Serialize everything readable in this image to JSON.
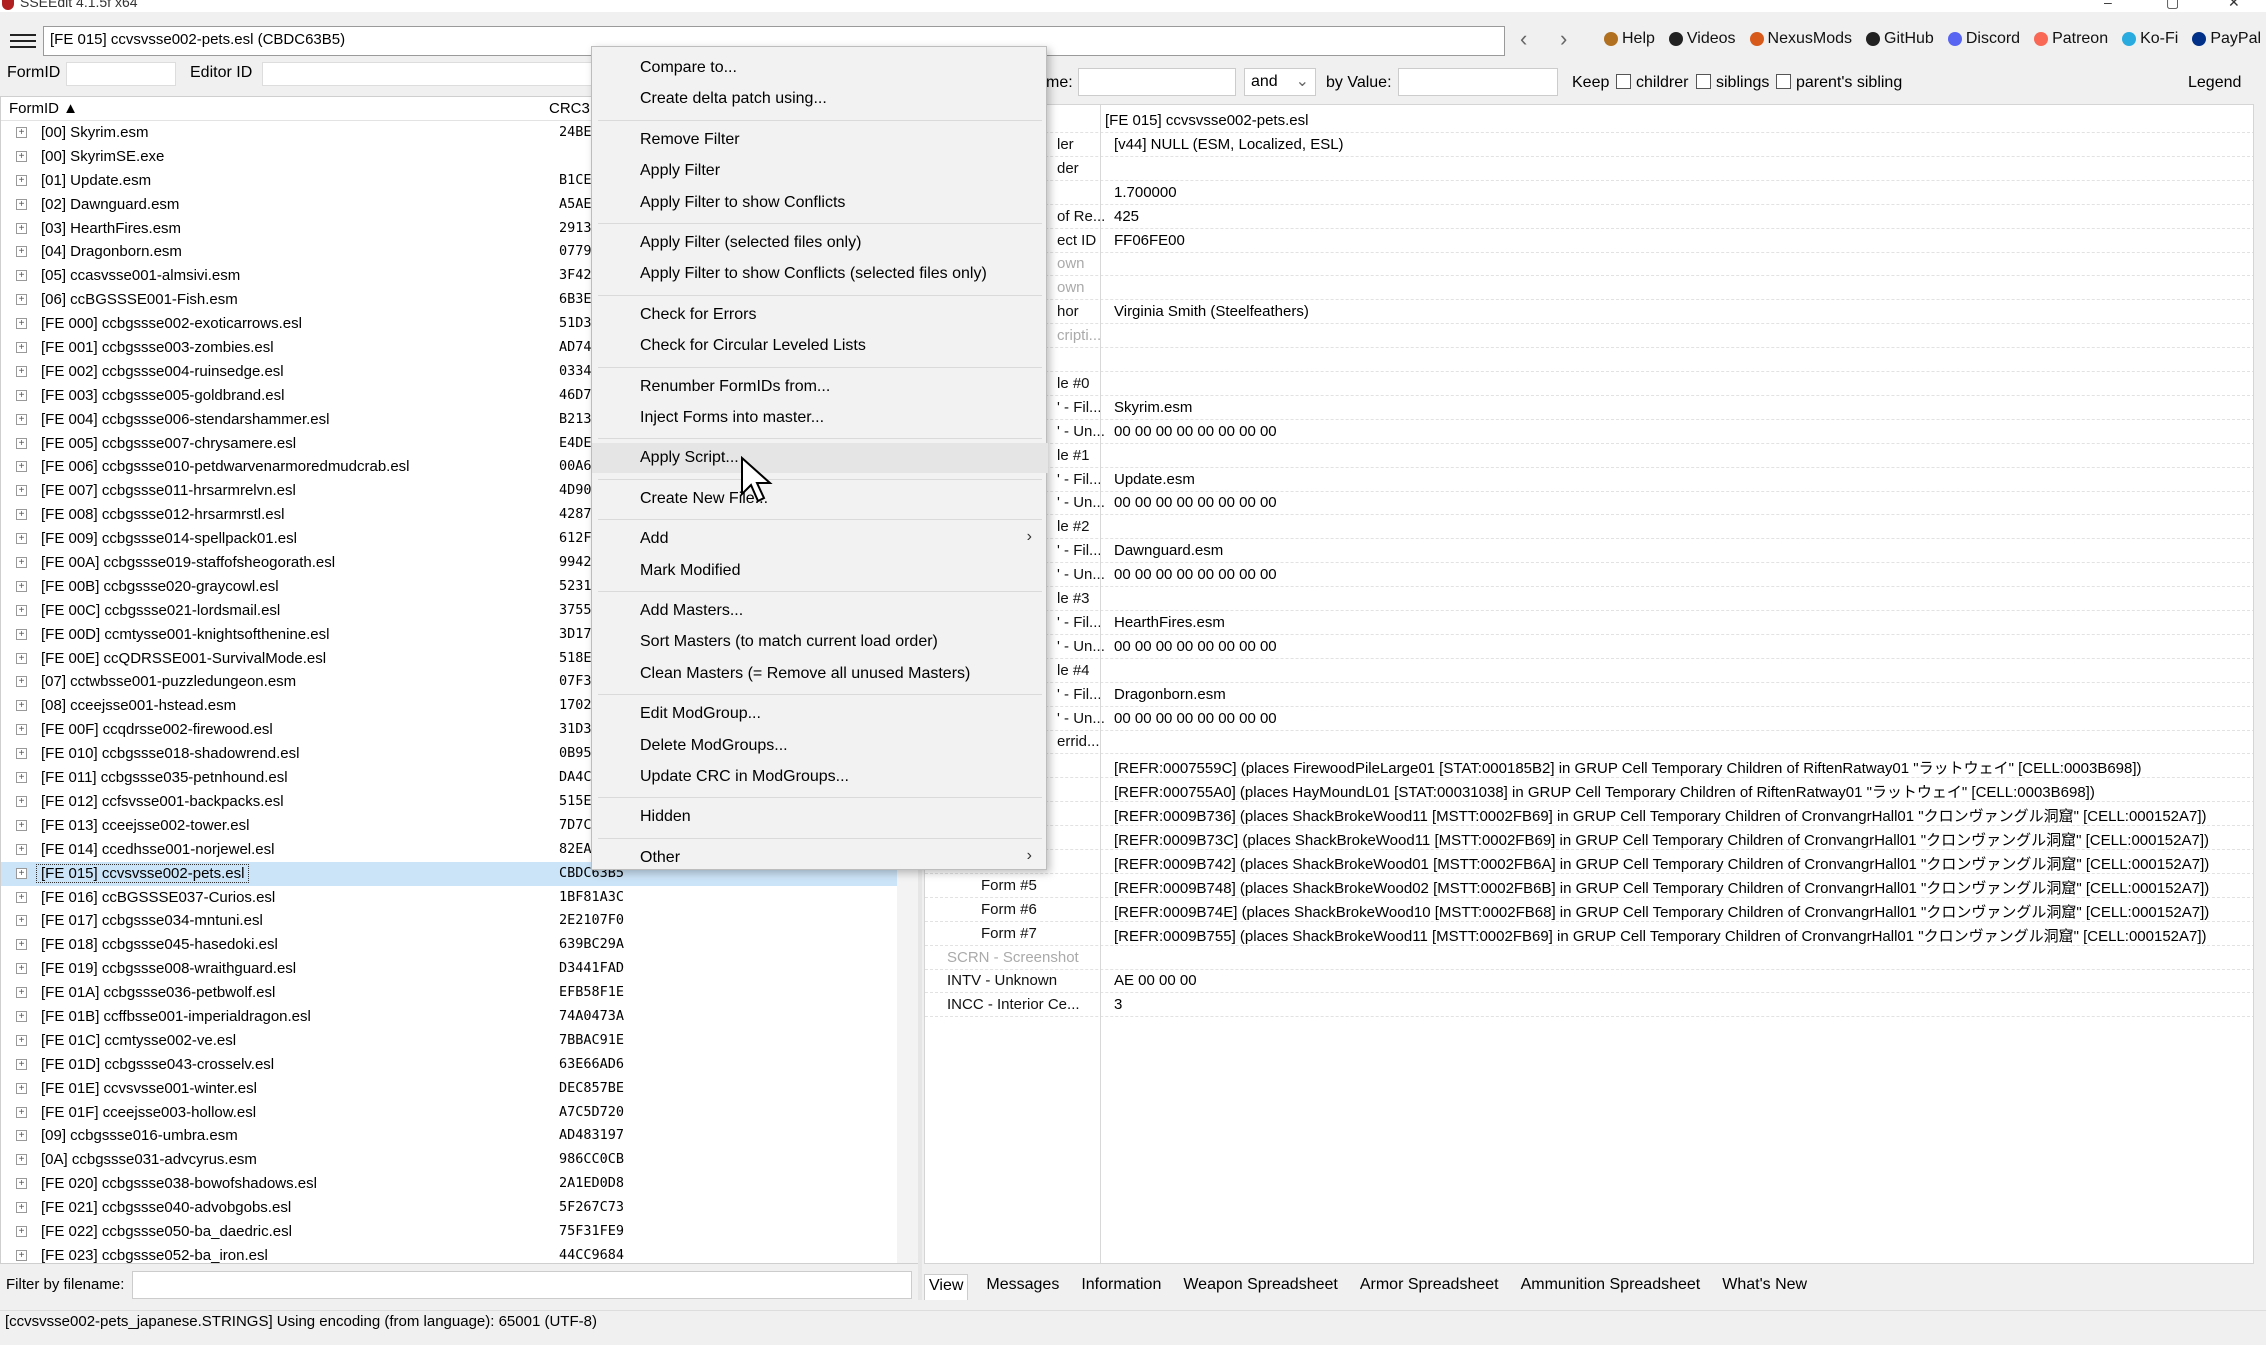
{
  "window": {
    "title": "SSEEdit 4.1.5f x64"
  },
  "toolbar": {
    "path": "[FE 015] ccvsvsse002-pets.esl (CBDC63B5)",
    "links": [
      {
        "label": "Help",
        "icon": "book-icon",
        "color": "#b07020"
      },
      {
        "label": "Videos",
        "icon": "video-icon",
        "color": "#222222"
      },
      {
        "label": "NexusMods",
        "icon": "nexus-icon",
        "color": "#d85a1a"
      },
      {
        "label": "GitHub",
        "icon": "github-icon",
        "color": "#222222"
      },
      {
        "label": "Discord",
        "icon": "discord-icon",
        "color": "#5865f2"
      },
      {
        "label": "Patreon",
        "icon": "patreon-icon",
        "color": "#f96854"
      },
      {
        "label": "Ko-Fi",
        "icon": "kofi-icon",
        "color": "#29abe0"
      },
      {
        "label": "PayPal",
        "icon": "paypal-icon",
        "color": "#003087"
      }
    ]
  },
  "left_header": {
    "formid_label": "FormID",
    "editorid_label": "Editor ID"
  },
  "tree": {
    "columns": [
      "FormID ▲",
      "CRC3"
    ],
    "rows": [
      {
        "name": "[00] Skyrim.esm",
        "crc": "24BE"
      },
      {
        "name": "[00] SkyrimSE.exe",
        "crc": ""
      },
      {
        "name": "[01] Update.esm",
        "crc": "B1CE"
      },
      {
        "name": "[02] Dawnguard.esm",
        "crc": "A5AE"
      },
      {
        "name": "[03] HearthFires.esm",
        "crc": "2913"
      },
      {
        "name": "[04] Dragonborn.esm",
        "crc": "0779"
      },
      {
        "name": "[05] ccasvsse001-almsivi.esm",
        "crc": "3F42"
      },
      {
        "name": "[06] ccBGSSSE001-Fish.esm",
        "crc": "6B3E"
      },
      {
        "name": "[FE 000] ccbgssse002-exoticarrows.esl",
        "crc": "51D3"
      },
      {
        "name": "[FE 001] ccbgssse003-zombies.esl",
        "crc": "AD74"
      },
      {
        "name": "[FE 002] ccbgssse004-ruinsedge.esl",
        "crc": "0334"
      },
      {
        "name": "[FE 003] ccbgssse005-goldbrand.esl",
        "crc": "46D7"
      },
      {
        "name": "[FE 004] ccbgssse006-stendarshammer.esl",
        "crc": "B213"
      },
      {
        "name": "[FE 005] ccbgssse007-chrysamere.esl",
        "crc": "E4DE"
      },
      {
        "name": "[FE 006] ccbgssse010-petdwarvenarmoredmudcrab.esl",
        "crc": "00A6"
      },
      {
        "name": "[FE 007] ccbgssse011-hrsarmrelvn.esl",
        "crc": "4D90"
      },
      {
        "name": "[FE 008] ccbgssse012-hrsarmrstl.esl",
        "crc": "4287"
      },
      {
        "name": "[FE 009] ccbgssse014-spellpack01.esl",
        "crc": "612F"
      },
      {
        "name": "[FE 00A] ccbgssse019-staffofsheogorath.esl",
        "crc": "9942"
      },
      {
        "name": "[FE 00B] ccbgssse020-graycowl.esl",
        "crc": "5231"
      },
      {
        "name": "[FE 00C] ccbgssse021-lordsmail.esl",
        "crc": "3755"
      },
      {
        "name": "[FE 00D] ccmtysse001-knightsofthenine.esl",
        "crc": "3D17"
      },
      {
        "name": "[FE 00E] ccQDRSSE001-SurvivalMode.esl",
        "crc": "518E"
      },
      {
        "name": "[07] cctwbsse001-puzzledungeon.esm",
        "crc": "07F3"
      },
      {
        "name": "[08] cceejsse001-hstead.esm",
        "crc": "1702"
      },
      {
        "name": "[FE 00F] ccqdrsse002-firewood.esl",
        "crc": "31D3"
      },
      {
        "name": "[FE 010] ccbgssse018-shadowrend.esl",
        "crc": "0B95"
      },
      {
        "name": "[FE 011] ccbgssse035-petnhound.esl",
        "crc": "DA4C"
      },
      {
        "name": "[FE 012] ccfsvsse001-backpacks.esl",
        "crc": "515E"
      },
      {
        "name": "[FE 013] cceejsse002-tower.esl",
        "crc": "7D7C"
      },
      {
        "name": "[FE 014] ccedhsse001-norjewel.esl",
        "crc": "82EA"
      },
      {
        "name": "[FE 015] ccvsvsse002-pets.esl",
        "crc": "CBDC63B5",
        "selected": true
      },
      {
        "name": "[FE 016] ccBGSSSE037-Curios.esl",
        "crc": "1BF81A3C"
      },
      {
        "name": "[FE 017] ccbgssse034-mntuni.esl",
        "crc": "2E2107F0"
      },
      {
        "name": "[FE 018] ccbgssse045-hasedoki.esl",
        "crc": "639BC29A"
      },
      {
        "name": "[FE 019] ccbgssse008-wraithguard.esl",
        "crc": "D3441FAD"
      },
      {
        "name": "[FE 01A] ccbgssse036-petbwolf.esl",
        "crc": "EFB58F1E"
      },
      {
        "name": "[FE 01B] ccffbsse001-imperialdragon.esl",
        "crc": "74A0473A"
      },
      {
        "name": "[FE 01C] ccmtysse002-ve.esl",
        "crc": "7BBAC91E"
      },
      {
        "name": "[FE 01D] ccbgssse043-crosselv.esl",
        "crc": "63E66AD6"
      },
      {
        "name": "[FE 01E] ccvsvsse001-winter.esl",
        "crc": "DEC857BE"
      },
      {
        "name": "[FE 01F] cceejsse003-hollow.esl",
        "crc": "A7C5D720"
      },
      {
        "name": "[09] ccbgssse016-umbra.esm",
        "crc": "AD483197"
      },
      {
        "name": "[0A] ccbgssse031-advcyrus.esm",
        "crc": "986CC0CB"
      },
      {
        "name": "[FE 020] ccbgssse038-bowofshadows.esl",
        "crc": "2A1ED0D8"
      },
      {
        "name": "[FE 021] ccbgssse040-advobgobs.esl",
        "crc": "5F267C73"
      },
      {
        "name": "[FE 022] ccbgssse050-ba_daedric.esl",
        "crc": "75F31FE9"
      },
      {
        "name": "[FE 023] ccbgssse052-ba_iron.esl",
        "crc": "44CC9684"
      }
    ]
  },
  "filter": {
    "label": "Filter by filename:"
  },
  "right_top": {
    "name_label": "me:",
    "and_label": "and",
    "by_value_label": "by Value:",
    "keep_label": "Keep",
    "children_label": "childrer",
    "siblings_label": "siblings",
    "parents_sibling_label": "parent's sibling",
    "legend_label": "Legend"
  },
  "record_view": {
    "rows": [
      {
        "k": "",
        "v": "[FE 015] ccvsvsse002-pets.esl"
      },
      {
        "k": "ler",
        "v": "[v44] NULL (ESM, Localized, ESL)"
      },
      {
        "k": "der",
        "v": ""
      },
      {
        "k": "",
        "v": "1.700000"
      },
      {
        "k": "of Re...",
        "v": "425"
      },
      {
        "k": "ect ID",
        "v": "FF06FE00"
      },
      {
        "k": "own",
        "v": ""
      },
      {
        "k": "own",
        "v": ""
      },
      {
        "k": "hor",
        "v": "Virginia Smith (Steelfeathers)"
      },
      {
        "k": "cripti...",
        "v": ""
      },
      {
        "k": "",
        "v": ""
      },
      {
        "k": "le #0",
        "v": ""
      },
      {
        "k": "' - Fil...",
        "v": "Skyrim.esm"
      },
      {
        "k": "' - Un...",
        "v": "00 00 00 00 00 00 00 00"
      },
      {
        "k": "le #1",
        "v": ""
      },
      {
        "k": "' - Fil...",
        "v": "Update.esm"
      },
      {
        "k": "' - Un...",
        "v": "00 00 00 00 00 00 00 00"
      },
      {
        "k": "le #2",
        "v": ""
      },
      {
        "k": "' - Fil...",
        "v": "Dawnguard.esm"
      },
      {
        "k": "' - Un...",
        "v": "00 00 00 00 00 00 00 00"
      },
      {
        "k": "le #3",
        "v": ""
      },
      {
        "k": "' - Fil...",
        "v": "HearthFires.esm"
      },
      {
        "k": "' - Un...",
        "v": "00 00 00 00 00 00 00 00"
      },
      {
        "k": "le #4",
        "v": ""
      },
      {
        "k": "' - Fil...",
        "v": "Dragonborn.esm"
      },
      {
        "k": "' - Un...",
        "v": "00 00 00 00 00 00 00 00"
      },
      {
        "k": "errid...",
        "v": ""
      },
      {
        "k": "",
        "v": "[REFR:0007559C] (places FirewoodPileLarge01 [STAT:000185B2] in GRUP Cell Temporary Children of RiftenRatway01 \"ラットウェイ\" [CELL:0003B698])"
      },
      {
        "k": "",
        "v": "[REFR:000755A0] (places HayMoundL01 [STAT:00031038] in GRUP Cell Temporary Children of RiftenRatway01 \"ラットウェイ\" [CELL:0003B698])"
      },
      {
        "k": "",
        "v": "[REFR:0009B736] (places ShackBrokeWood11 [MSTT:0002FB69] in GRUP Cell Temporary Children of CronvangrHall01 \"クロンヴァングル洞窟\" [CELL:000152A7])"
      },
      {
        "k": "",
        "v": "[REFR:0009B73C] (places ShackBrokeWood11 [MSTT:0002FB69] in GRUP Cell Temporary Children of CronvangrHall01 \"クロンヴァングル洞窟\" [CELL:000152A7])"
      },
      {
        "k": "",
        "v": "[REFR:0009B742] (places ShackBrokeWood01 [MSTT:0002FB6A] in GRUP Cell Temporary Children of CronvangrHall01 \"クロンヴァングル洞窟\" [CELL:000152A7])"
      },
      {
        "k": "Form #5",
        "v": "[REFR:0009B748] (places ShackBrokeWood02 [MSTT:0002FB6B] in GRUP Cell Temporary Children of CronvangrHall01 \"クロンヴァングル洞窟\" [CELL:000152A7])"
      },
      {
        "k": "Form #6",
        "v": "[REFR:0009B74E] (places ShackBrokeWood10 [MSTT:0002FB68] in GRUP Cell Temporary Children of CronvangrHall01 \"クロンヴァングル洞窟\" [CELL:000152A7])"
      },
      {
        "k": "Form #7",
        "v": "[REFR:0009B755] (places ShackBrokeWood11 [MSTT:0002FB69] in GRUP Cell Temporary Children of CronvangrHall01 \"クロンヴァングル洞窟\" [CELL:000152A7])"
      },
      {
        "k": "SCRN - Screenshot",
        "v": ""
      },
      {
        "k": "INTV - Unknown",
        "v": "AE 00 00 00"
      },
      {
        "k": "INCC - Interior Ce...",
        "v": "3"
      }
    ]
  },
  "tabs": [
    "View",
    "Messages",
    "Information",
    "Weapon Spreadsheet",
    "Armor Spreadsheet",
    "Ammunition Spreadsheet",
    "What's New"
  ],
  "status": {
    "text": "[ccvsvsse002-pets_japanese.STRINGS] Using encoding (from language): 65001 (UTF-8)"
  },
  "context_menu": {
    "items": [
      {
        "label": "Compare to...",
        "group": 0
      },
      {
        "label": "Create delta patch using...",
        "group": 0
      },
      {
        "label": "Remove Filter",
        "group": 1
      },
      {
        "label": "Apply Filter",
        "group": 1
      },
      {
        "label": "Apply Filter to show Conflicts",
        "group": 1
      },
      {
        "label": "Apply Filter (selected files only)",
        "group": 2
      },
      {
        "label": "Apply Filter to show Conflicts (selected files only)",
        "group": 2
      },
      {
        "label": "Check for Errors",
        "group": 3
      },
      {
        "label": "Check for Circular Leveled Lists",
        "group": 3
      },
      {
        "label": "Renumber FormIDs from...",
        "group": 4
      },
      {
        "label": "Inject Forms into master...",
        "group": 4
      },
      {
        "label": "Apply Script...",
        "group": 5,
        "hover": true
      },
      {
        "label": "Create New File...",
        "group": 6
      },
      {
        "label": "Add",
        "group": 7,
        "submenu": true
      },
      {
        "label": "Mark Modified",
        "group": 7
      },
      {
        "label": "Add Masters...",
        "group": 8
      },
      {
        "label": "Sort Masters (to match current load order)",
        "group": 8
      },
      {
        "label": "Clean Masters (= Remove all unused Masters)",
        "group": 8
      },
      {
        "label": "Edit ModGroup...",
        "group": 9
      },
      {
        "label": "Delete ModGroups...",
        "group": 9
      },
      {
        "label": "Update CRC in ModGroups...",
        "group": 9
      },
      {
        "label": "Hidden",
        "group": 10
      },
      {
        "label": "Other",
        "group": 11,
        "submenu": true
      }
    ]
  }
}
